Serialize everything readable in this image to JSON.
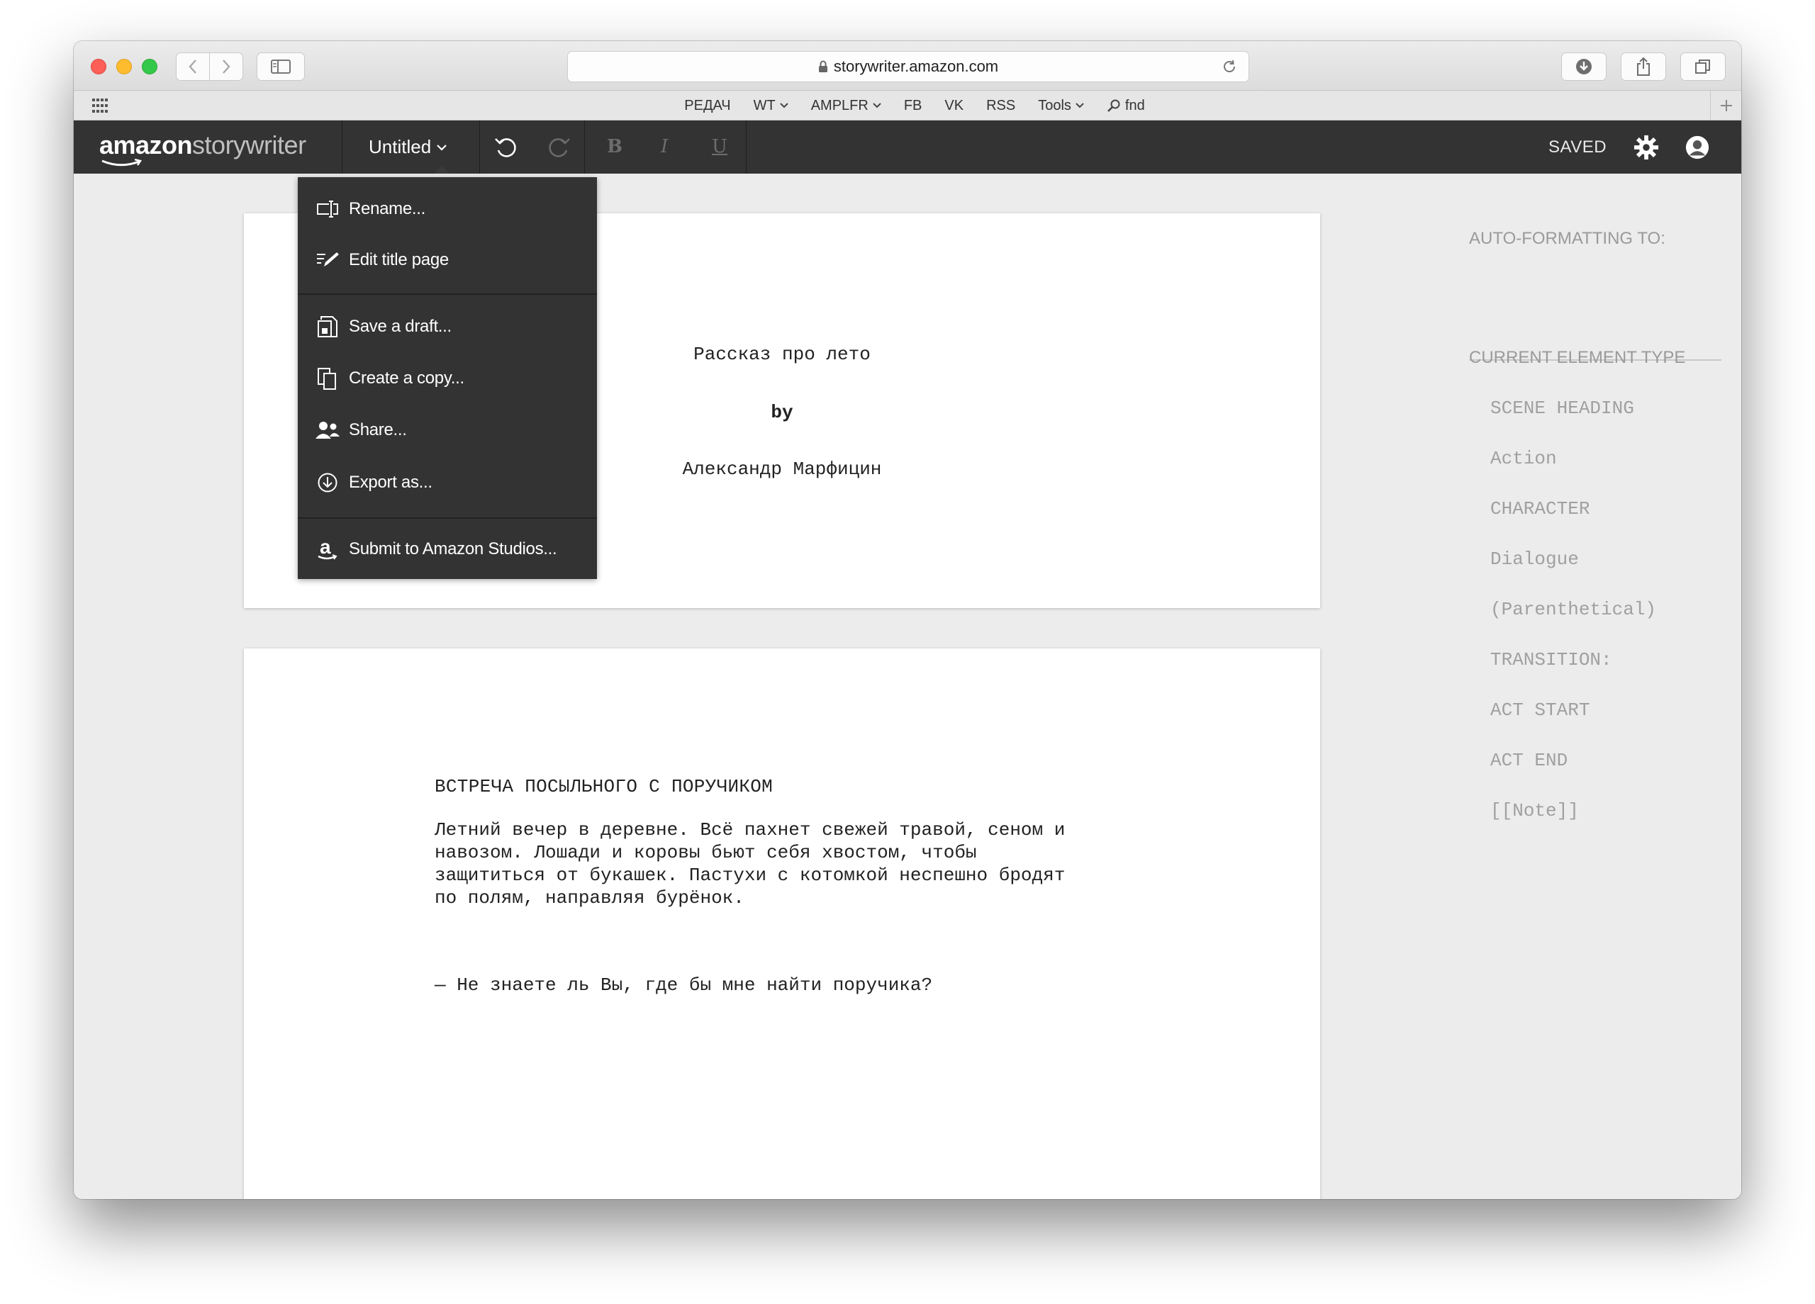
{
  "browser": {
    "url": "storywriter.amazon.com",
    "bookmarks": [
      "РЕДАЧ",
      "WT",
      "AMPLFR",
      "FB",
      "VK",
      "RSS",
      "Tools",
      "fnd"
    ]
  },
  "app": {
    "logo_amazon": "amazon",
    "logo_storywriter": "storywriter",
    "document_title": "Untitled",
    "status": "SAVED",
    "format_bold": "B",
    "format_italic": "I",
    "format_underline": "U"
  },
  "menu": {
    "items": [
      "Rename...",
      "Edit title page",
      "Save a draft...",
      "Create a copy...",
      "Share...",
      "Export as...",
      "Submit to Amazon Studios..."
    ]
  },
  "title_page": {
    "title": "Рассказ про лето",
    "by": "by",
    "author": "Александр Марфицин"
  },
  "script": {
    "scene_heading": "ВСТРЕЧА ПОСЫЛЬНОГО С ПОРУЧИКОМ",
    "action": "Летний вечер в деревне. Всё пахнет свежей травой, сеном и\nнавозом. Лошади и коровы бьют себя хвостом, чтобы\nзащититься от букашек. Пастухи с котомкой неспешно бродят\nпо полям, направляя бурёнок.",
    "dialogue": "— Не знаете ль Вы, где бы мне найти поручика?"
  },
  "panel": {
    "auto_formatting_label": "AUTO-FORMATTING TO:",
    "current_element_label": "CURRENT ELEMENT TYPE",
    "element_types": [
      "SCENE HEADING",
      "Action",
      "CHARACTER",
      "Dialogue",
      "(Parenthetical)",
      "TRANSITION:",
      "ACT START",
      "ACT END",
      "[[Note]]"
    ]
  },
  "colors": {
    "toolbar_bg": "#333333",
    "menu_bg": "#333333",
    "page_bg": "#ffffff",
    "workspace_bg": "#ececec"
  }
}
